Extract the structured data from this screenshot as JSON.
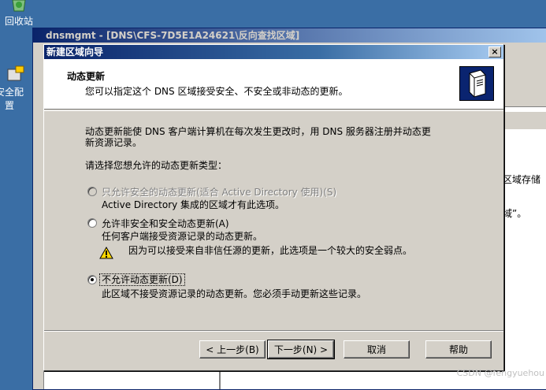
{
  "desktop": {
    "recycle_bin_label": "回收站",
    "security_config_label": "安全配置"
  },
  "mmc": {
    "title": "dnsmgmt - [DNS\\CFS-7D5E1A24621\\反向查找区域]",
    "right_text_1": "区域存储",
    "right_text_2": "域”。"
  },
  "wizard": {
    "title": "新建区域向导",
    "close_label": "×",
    "header_title": "动态更新",
    "header_subtitle": "您可以指定这个 DNS 区域接受安全、不安全或非动态的更新。",
    "intro_line1": "动态更新能使 DNS 客户端计算机在每次发生更改时，用 DNS 服务器注册并动态更",
    "intro_line2": "新资源记录。",
    "prompt": "请选择您想允许的动态更新类型：",
    "options": [
      {
        "label": "只允许安全的动态更新(适合 Active Directory 使用)(S)",
        "description": "Active Directory 集成的区域才有此选项。",
        "selected": false,
        "enabled": false
      },
      {
        "label": "允许非安全和安全动态更新(A)",
        "description": "任何客户端接受资源记录的动态更新。",
        "warning": "因为可以接受来自非信任源的更新，此选项是一个较大的安全弱点。",
        "selected": false,
        "enabled": true
      },
      {
        "label": "不允许动态更新(D)",
        "description": "此区域不接受资源记录的动态更新。您必须手动更新这些记录。",
        "selected": true,
        "enabled": true
      }
    ],
    "buttons": {
      "back": "< 上一步(B)",
      "next": "下一步(N) >",
      "cancel": "取消",
      "help": "帮助"
    }
  },
  "watermark": "CSDN @fengyuehou",
  "colors": {
    "desktop_bg": "#3a6ea5",
    "dialog_bg": "#d4d0c8",
    "title_active": "#0a246a"
  }
}
